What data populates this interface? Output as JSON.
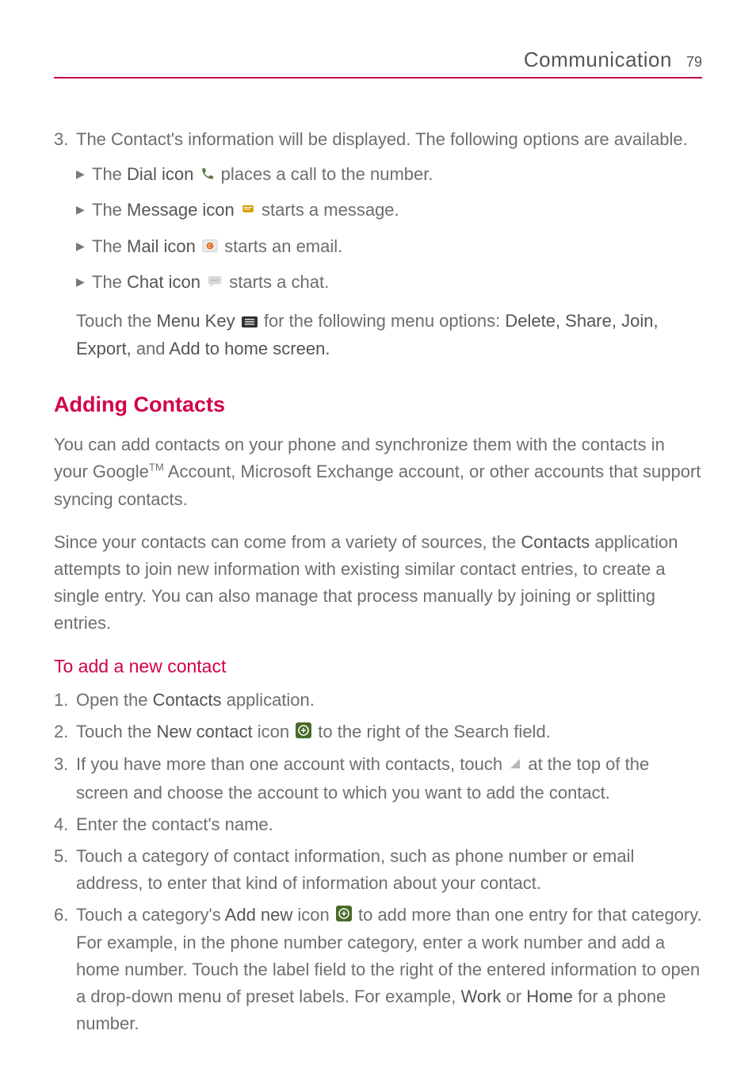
{
  "header": {
    "section_title": "Communication",
    "page_number": "79"
  },
  "item3": {
    "num": "3.",
    "intro": "The Contact's information will be displayed. The following options are available.",
    "bullets": {
      "b1_pre": "The ",
      "b1_bold": "Dial icon",
      "b1_post": " places a call to the number.",
      "b2_pre": "The ",
      "b2_bold": "Message icon",
      "b2_post": " starts a message.",
      "b3_pre": "The ",
      "b3_bold": "Mail icon",
      "b3_post": " starts an email.",
      "b4_pre": "The ",
      "b4_bold": "Chat icon",
      "b4_post": " starts a chat."
    },
    "touch": {
      "t1": "Touch the ",
      "t2": "Menu Key",
      "t3": " for the following menu options: ",
      "t4": "Delete, Share, Join, Export,",
      "t5": " and ",
      "t6": "Add to home screen."
    }
  },
  "section": {
    "h2": "Adding Contacts",
    "p1_a": "You can add contacts on your phone and synchronize them with the contacts in your Google",
    "p1_tm": "TM",
    "p1_b": " Account, Microsoft Exchange account, or other accounts that support syncing contacts.",
    "p2_a": "Since your contacts can come from a variety of sources, the ",
    "p2_bold": "Contacts",
    "p2_b": " application attempts to join new information with existing similar contact entries, to create a single entry. You can also manage that process manually by joining or splitting entries.",
    "h3": "To add a new contact"
  },
  "steps": {
    "s1": {
      "num": "1.",
      "a": "Open the ",
      "b": "Contacts",
      "c": " application."
    },
    "s2": {
      "num": "2.",
      "a": "Touch the ",
      "b": "New contact",
      "c": " icon ",
      "d": " to the right of the Search field."
    },
    "s3": {
      "num": "3.",
      "a": "If you have more than one account with contacts, touch ",
      "b": " at the top of the screen and choose the account to which you want to add the contact."
    },
    "s4": {
      "num": "4.",
      "a": "Enter the contact's name."
    },
    "s5": {
      "num": "5.",
      "a": "Touch a category of contact information, such as phone number or email address, to enter that kind of information about your contact."
    },
    "s6": {
      "num": "6.",
      "a": "Touch a category's ",
      "b": "Add new",
      "c": " icon ",
      "d": " to add more than one entry for that category. For example, in the phone number category, enter a work number and add a home number. Touch the label field to the right of the entered information to open a drop-down menu of preset labels. For example, ",
      "e": "Work",
      "f": " or ",
      "g": "Home",
      "h": " for a phone number."
    }
  }
}
